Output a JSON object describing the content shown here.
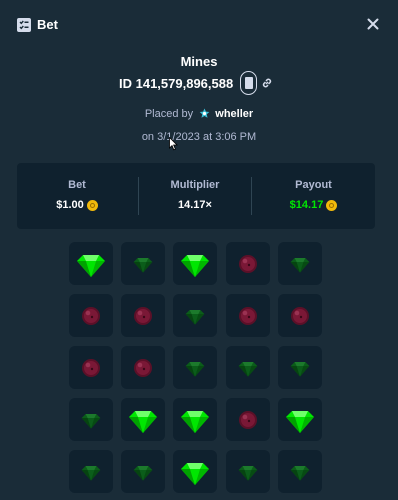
{
  "header": {
    "title": "Bet",
    "icon": "bet-slip-icon",
    "close_icon": "close-icon"
  },
  "bet": {
    "game": "Mines",
    "id_label": "ID 141,579,896,588",
    "placed_by_label": "Placed by",
    "user": "wheller",
    "date_label": "on 3/1/2023 at 3:06 PM"
  },
  "stats": {
    "bet_label": "Bet",
    "bet_value": "$1.00",
    "multiplier_label": "Multiplier",
    "multiplier_value": "14.17×",
    "payout_label": "Payout",
    "payout_value": "$14.17",
    "payout_color": "#00e701"
  },
  "board": {
    "legend": {
      "G": "gem-revealed",
      "g": "gem-unrevealed",
      "m": "mine"
    },
    "rows": [
      [
        "G",
        "g",
        "G",
        "m",
        "g"
      ],
      [
        "m",
        "m",
        "g",
        "m",
        "m"
      ],
      [
        "m",
        "m",
        "g",
        "g",
        "g"
      ],
      [
        "g",
        "G",
        "G",
        "m",
        "G"
      ],
      [
        "g",
        "g",
        "G",
        "g",
        "g"
      ]
    ]
  }
}
